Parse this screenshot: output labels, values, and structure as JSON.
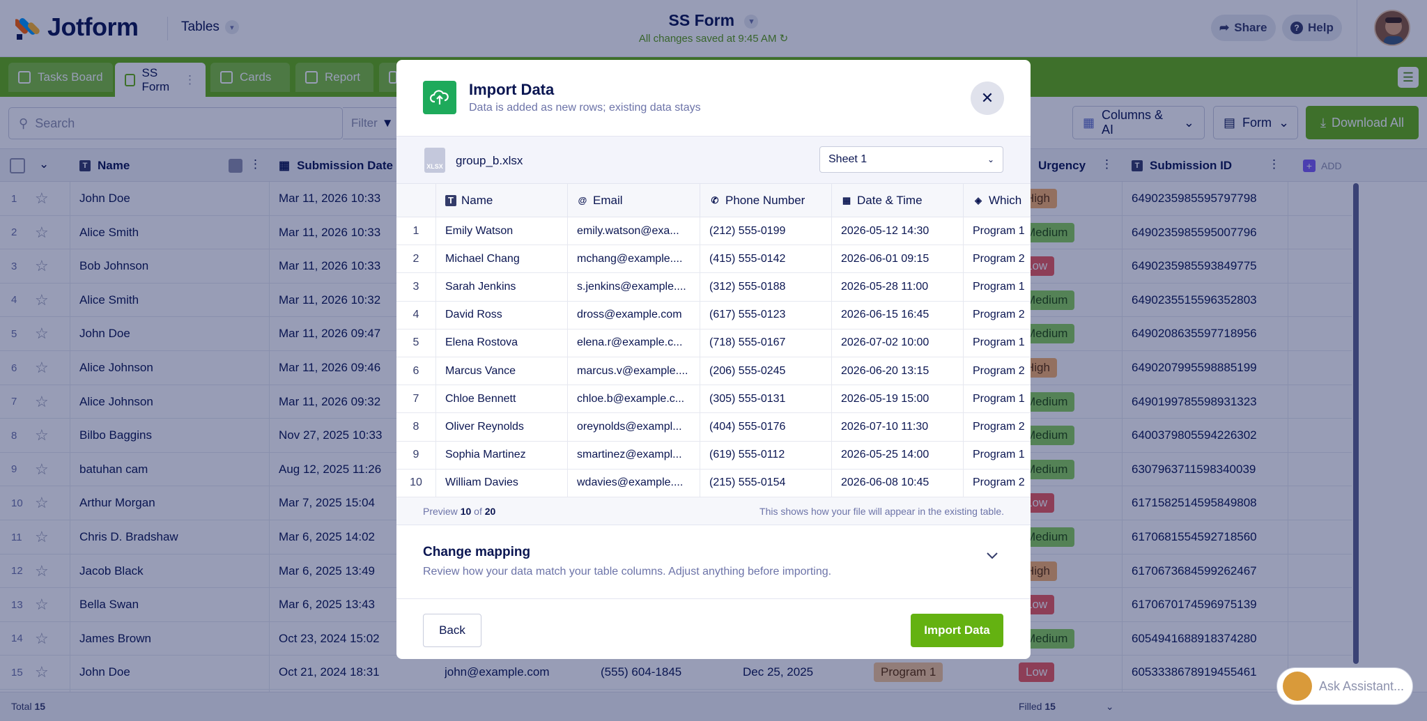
{
  "header": {
    "brand": "Jotform",
    "tables_label": "Tables",
    "form_title": "SS Form",
    "saved_status": "All changes saved at 9:45 AM",
    "share_label": "Share",
    "help_label": "Help"
  },
  "tabs": [
    {
      "label": "Tasks Board"
    },
    {
      "label": "SS Form"
    },
    {
      "label": "Cards"
    },
    {
      "label": "Report"
    }
  ],
  "toolbar": {
    "search_placeholder": "Search",
    "filter_label": "Filter",
    "columns_label": "Columns & AI",
    "form_label": "Form",
    "download_label": "Download All"
  },
  "grid": {
    "headers": {
      "name": "Name",
      "submission_date": "Submission Date",
      "urgency": "Urgency",
      "submission_id": "Submission ID",
      "add": "ADD"
    },
    "rows": [
      {
        "n": "1",
        "name": "John Doe",
        "date": "Mar 11, 2026 10:33",
        "urgency": "High",
        "uclass": "b-high",
        "id": "6490235985595797798"
      },
      {
        "n": "2",
        "name": "Alice Smith",
        "date": "Mar 11, 2026 10:33",
        "urgency": "Medium",
        "uclass": "b-med",
        "id": "6490235985595007796"
      },
      {
        "n": "3",
        "name": "Bob Johnson",
        "date": "Mar 11, 2026 10:33",
        "urgency": "Low",
        "uclass": "b-low",
        "id": "6490235985593849775"
      },
      {
        "n": "4",
        "name": "Alice Smith",
        "date": "Mar 11, 2026 10:32",
        "urgency": "Medium",
        "uclass": "b-med",
        "id": "6490235515596352803"
      },
      {
        "n": "5",
        "name": "John Doe",
        "date": "Mar 11, 2026 09:47",
        "urgency": "Medium",
        "uclass": "b-med",
        "id": "6490208635597718956"
      },
      {
        "n": "6",
        "name": "Alice Johnson",
        "date": "Mar 11, 2026 09:46",
        "urgency": "High",
        "uclass": "b-high",
        "id": "6490207995598885199"
      },
      {
        "n": "7",
        "name": "Alice Johnson",
        "date": "Mar 11, 2026 09:32",
        "urgency": "Medium",
        "uclass": "b-med",
        "id": "6490199785598931323"
      },
      {
        "n": "8",
        "name": "Bilbo Baggins",
        "date": "Nov 27, 2025 10:33",
        "urgency": "Medium",
        "uclass": "b-med",
        "id": "6400379805594226302"
      },
      {
        "n": "9",
        "name": "batuhan cam",
        "date": "Aug 12, 2025 11:26",
        "urgency": "Medium",
        "uclass": "b-med",
        "id": "6307963711598340039"
      },
      {
        "n": "10",
        "name": "Arthur Morgan",
        "date": "Mar 7, 2025 15:04",
        "urgency": "Low",
        "uclass": "b-low",
        "id": "6171582514595849808"
      },
      {
        "n": "11",
        "name": "Chris D. Bradshaw",
        "date": "Mar 6, 2025 14:02",
        "urgency": "Medium",
        "uclass": "b-med",
        "id": "6170681554592718560"
      },
      {
        "n": "12",
        "name": "Jacob Black",
        "date": "Mar 6, 2025 13:49",
        "urgency": "High",
        "uclass": "b-high",
        "id": "6170673684599262467"
      },
      {
        "n": "13",
        "name": "Bella Swan",
        "date": "Mar 6, 2025 13:43",
        "urgency": "Low",
        "uclass": "b-low",
        "id": "6170670174596975139"
      },
      {
        "n": "14",
        "name": "James Brown",
        "date": "Oct 23, 2024 15:02",
        "urgency": "Medium",
        "uclass": "b-med",
        "id": "6054941688918374280"
      },
      {
        "n": "15",
        "name": "John Doe",
        "date": "Oct 21, 2024 18:31",
        "urgency": "Low",
        "uclass": "b-low",
        "id": "6053338678919455461",
        "email": "john@example.com",
        "phone": "(555) 604-1845",
        "event_date": "Dec 25, 2025",
        "program": "Program 1"
      }
    ],
    "footer_total_label": "Total",
    "footer_total": "15",
    "footer_filled_label": "Filled",
    "footer_filled": "15"
  },
  "assistant": {
    "label": "Ask Assistant..."
  },
  "modal": {
    "title": "Import Data",
    "subtitle": "Data is added as new rows; existing data stays",
    "file_name": "group_b.xlsx",
    "file_type": "XLSX",
    "sheet": "Sheet 1",
    "columns": [
      "Name",
      "Email",
      "Phone Number",
      "Date & Time",
      "Which"
    ],
    "rows": [
      {
        "n": "1",
        "name": "Emily Watson",
        "email": "emily.watson@exa...",
        "phone": "(212) 555-0199",
        "dt": "2026-05-12 14:30",
        "which": "Program 1"
      },
      {
        "n": "2",
        "name": "Michael Chang",
        "email": "mchang@example....",
        "phone": "(415) 555-0142",
        "dt": "2026-06-01 09:15",
        "which": "Program 2"
      },
      {
        "n": "3",
        "name": "Sarah Jenkins",
        "email": "s.jenkins@example....",
        "phone": "(312) 555-0188",
        "dt": "2026-05-28 11:00",
        "which": "Program 1"
      },
      {
        "n": "4",
        "name": "David Ross",
        "email": "dross@example.com",
        "phone": "(617) 555-0123",
        "dt": "2026-06-15 16:45",
        "which": "Program 2"
      },
      {
        "n": "5",
        "name": "Elena Rostova",
        "email": "elena.r@example.c...",
        "phone": "(718) 555-0167",
        "dt": "2026-07-02 10:00",
        "which": "Program 1"
      },
      {
        "n": "6",
        "name": "Marcus Vance",
        "email": "marcus.v@example....",
        "phone": "(206) 555-0245",
        "dt": "2026-06-20 13:15",
        "which": "Program 2"
      },
      {
        "n": "7",
        "name": "Chloe Bennett",
        "email": "chloe.b@example.c...",
        "phone": "(305) 555-0131",
        "dt": "2026-05-19 15:00",
        "which": "Program 1"
      },
      {
        "n": "8",
        "name": "Oliver Reynolds",
        "email": "oreynolds@exampl...",
        "phone": "(404) 555-0176",
        "dt": "2026-07-10 11:30",
        "which": "Program 2"
      },
      {
        "n": "9",
        "name": "Sophia Martinez",
        "email": "smartinez@exampl...",
        "phone": "(619) 555-0112",
        "dt": "2026-05-25 14:00",
        "which": "Program 1"
      },
      {
        "n": "10",
        "name": "William Davies",
        "email": "wdavies@example....",
        "phone": "(215) 555-0154",
        "dt": "2026-06-08 10:45",
        "which": "Program 2"
      }
    ],
    "preview_prefix": "Preview",
    "preview_shown": "10",
    "preview_of": "of",
    "preview_total": "20",
    "preview_note": "This shows how your file will appear in the existing table.",
    "mapping_title": "Change mapping",
    "mapping_subtitle": "Review how your data match your table columns. Adjust anything before importing.",
    "back_label": "Back",
    "import_label": "Import Data"
  },
  "colors": {
    "brand_green": "#64b211",
    "navy": "#0a1551",
    "overlay": "rgba(10,21,81,0.42)"
  }
}
